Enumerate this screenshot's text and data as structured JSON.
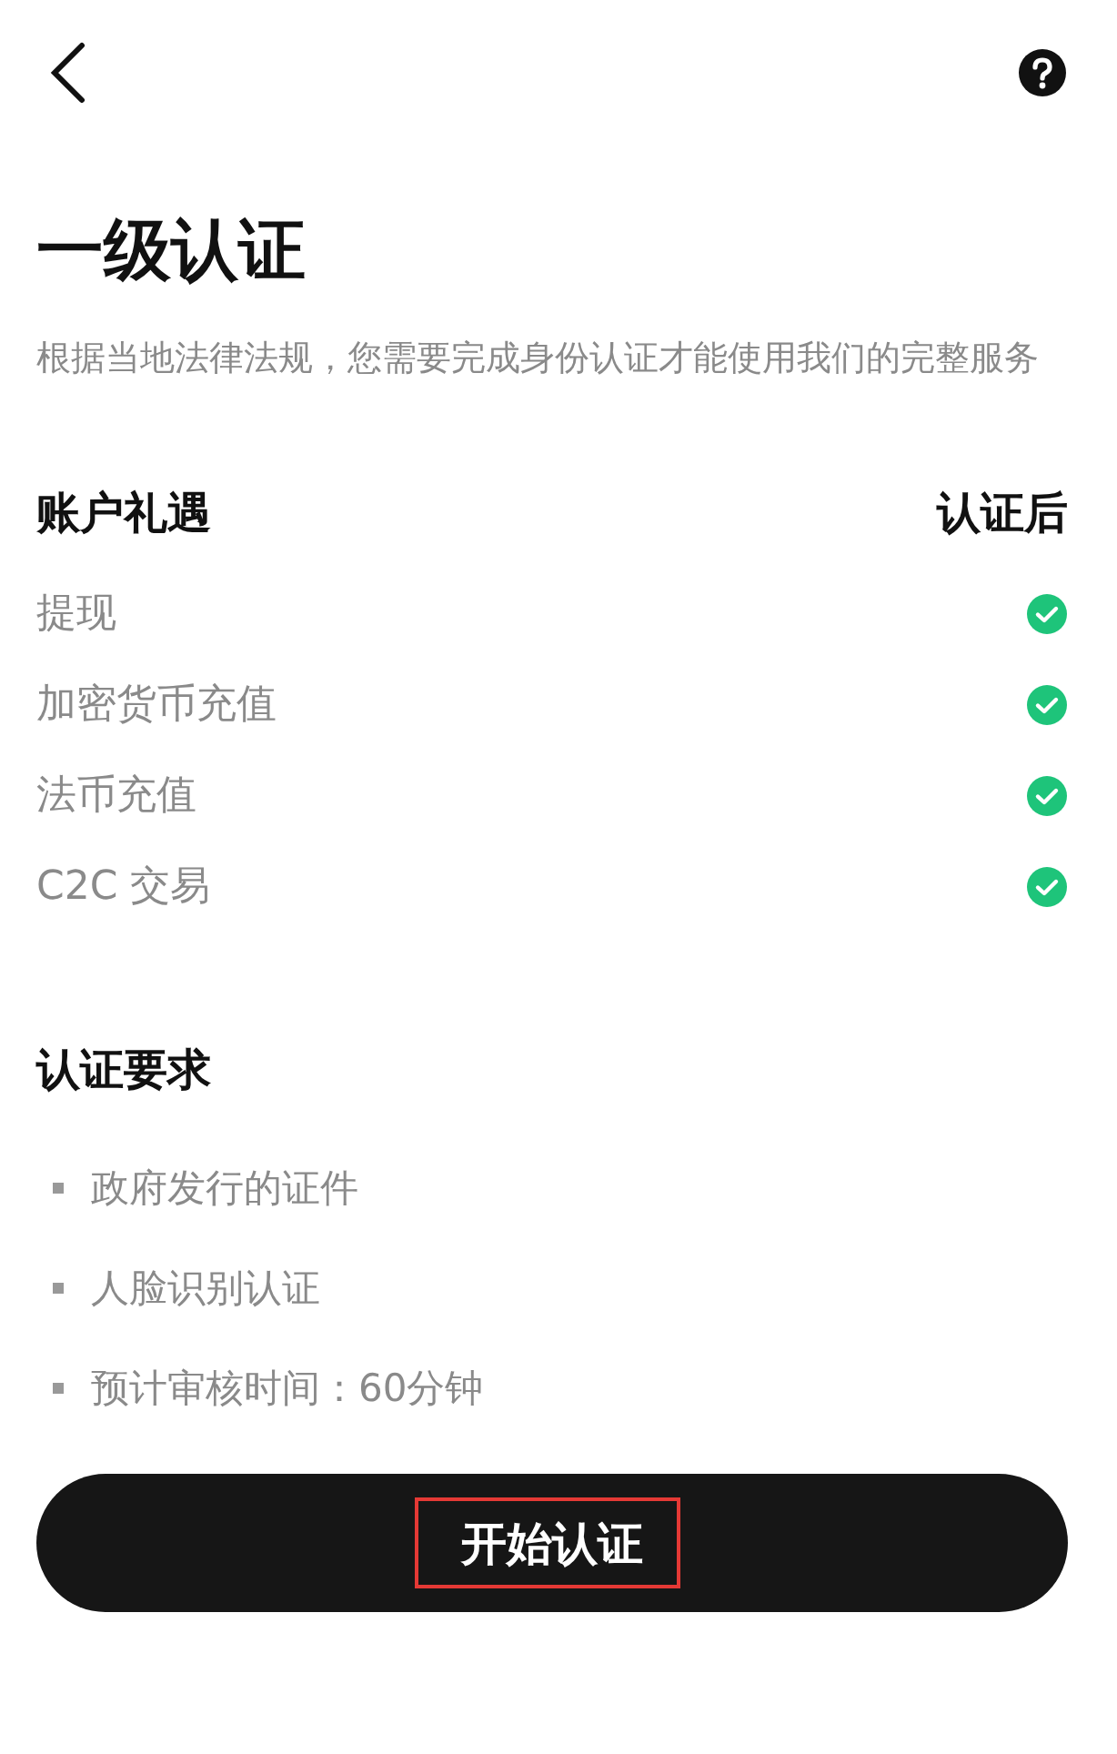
{
  "title": "一级认证",
  "description": "根据当地法律法规，您需要完成身份认证才能使用我们的完整服务",
  "benefits": {
    "heading": "账户礼遇",
    "column": "认证后",
    "rows": [
      {
        "label": "提现",
        "checked": true
      },
      {
        "label": "加密货币充值",
        "checked": true
      },
      {
        "label": "法币充值",
        "checked": true
      },
      {
        "label": "C2C 交易",
        "checked": true
      }
    ]
  },
  "requirements": {
    "heading": "认证要求",
    "items": [
      "政府发行的证件",
      "人脸识别认证",
      "预计审核时间：60分钟"
    ]
  },
  "button": {
    "label": "开始认证",
    "highlighted": true
  }
}
